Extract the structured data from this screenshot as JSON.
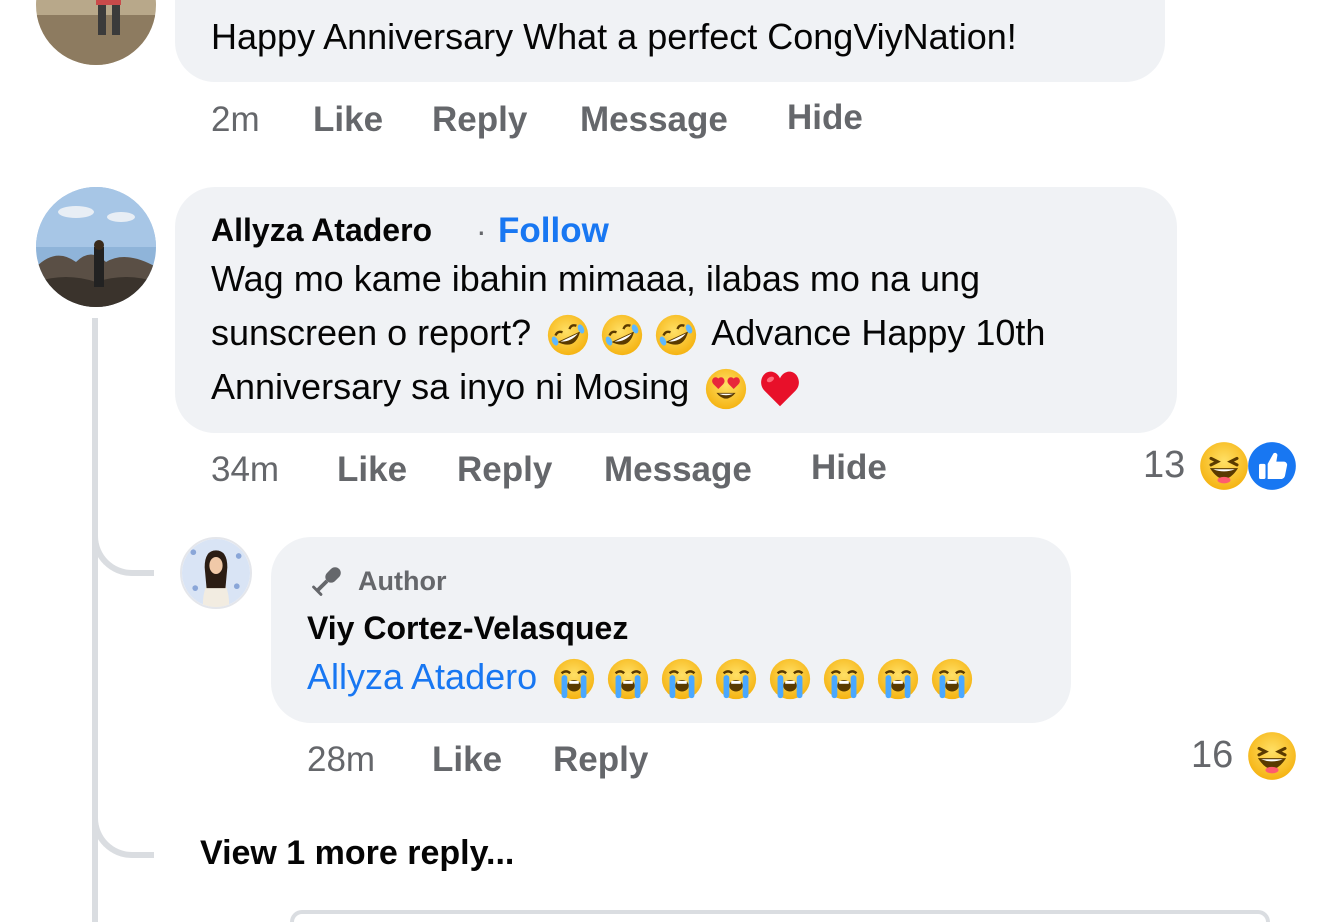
{
  "comment1": {
    "text": "Happy Anniversary What a perfect CongViyNation!",
    "time": "2m",
    "like": "Like",
    "reply": "Reply",
    "message": "Message",
    "hide": "Hide"
  },
  "comment2": {
    "name": "Allyza Atadero",
    "separator": "·",
    "follow": "Follow",
    "line1": "Wag mo kame ibahin mimaaa, ilabas mo na ung",
    "line2_start": "sunscreen o report?",
    "line2_end": "Advance Happy 10th",
    "line3_start": "Anniversary sa inyo ni Mosing",
    "time": "34m",
    "like": "Like",
    "reply": "Reply",
    "message": "Message",
    "hide": "Hide",
    "reaction_count": "13"
  },
  "reply1": {
    "badge": "Author",
    "name": "Viy Cortez-Velasquez",
    "mention": "Allyza Atadero",
    "time": "28m",
    "like": "Like",
    "reply": "Reply",
    "reaction_count": "16"
  },
  "view_more": "View 1 more reply...",
  "colors": {
    "bubble": "#f0f2f5",
    "link": "#1877f2",
    "meta": "#65676b",
    "thread": "#dadde1"
  },
  "icons": {
    "laughing": "rolling-on-floor-laughing-emoji",
    "heart_eyes": "heart-eyes-emoji",
    "heart": "red-heart-emoji",
    "crying": "loudly-crying-emoji",
    "haha": "haha-reaction-icon",
    "like": "like-reaction-icon",
    "author": "microphone-icon"
  }
}
